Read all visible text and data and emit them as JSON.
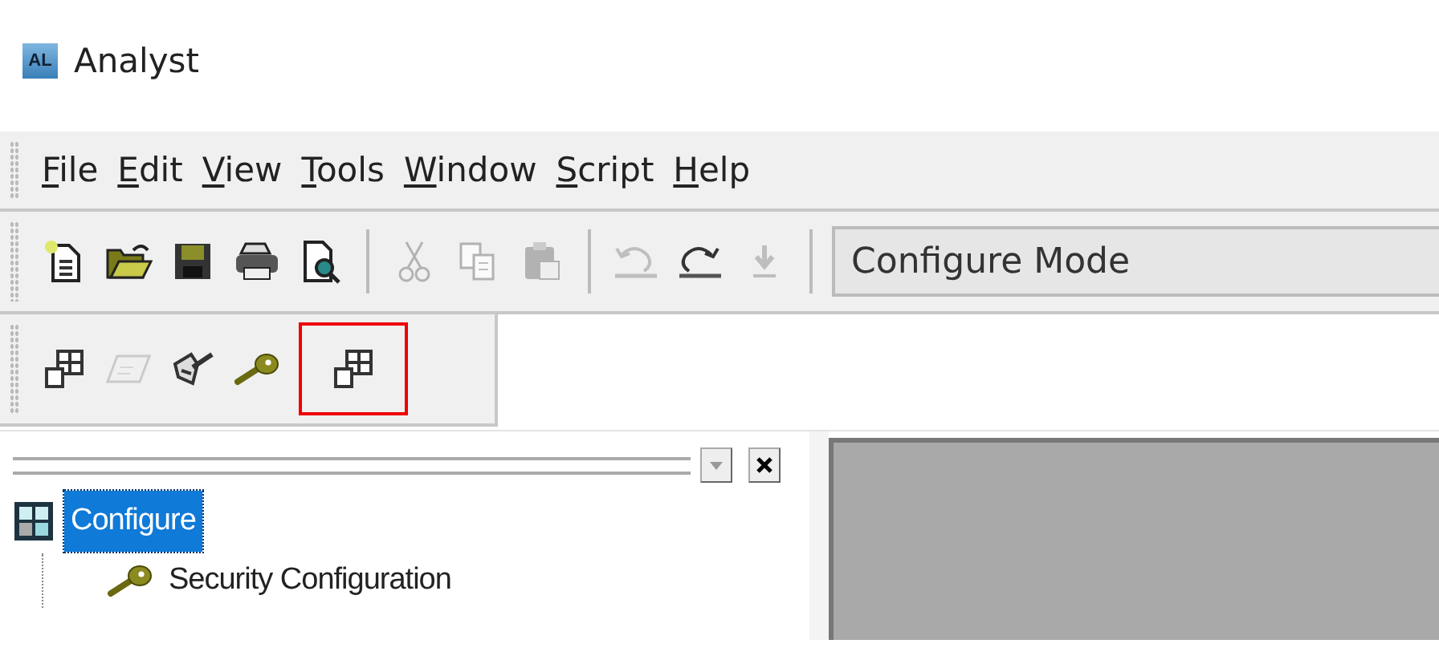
{
  "window": {
    "title": "Analyst",
    "logo": "AL"
  },
  "menu": [
    "File",
    "Edit",
    "View",
    "Tools",
    "Window",
    "Script",
    "Help"
  ],
  "toolbar": {
    "groups": [
      [
        {
          "kind": "new",
          "disabled": false,
          "highlighted": false
        },
        {
          "kind": "open",
          "disabled": false,
          "highlighted": false
        },
        {
          "kind": "save",
          "disabled": false,
          "highlighted": false
        },
        {
          "kind": "print",
          "disabled": false,
          "highlighted": false
        },
        {
          "kind": "preview",
          "disabled": false,
          "highlighted": false
        }
      ],
      [
        {
          "kind": "cut",
          "disabled": true,
          "highlighted": false
        },
        {
          "kind": "copy",
          "disabled": true,
          "highlighted": false
        },
        {
          "kind": "paste",
          "disabled": true,
          "highlighted": false
        }
      ],
      [
        {
          "kind": "undo",
          "disabled": true,
          "highlighted": false
        },
        {
          "kind": "redo",
          "disabled": false,
          "highlighted": false
        },
        {
          "kind": "down",
          "disabled": true,
          "highlighted": false
        }
      ]
    ],
    "mode_field": {
      "value": "Configure Mode"
    }
  },
  "toolbar_2": {
    "tools": [
      {
        "kind": "grid",
        "disabled": false,
        "highlighted": false
      },
      {
        "kind": "slant",
        "disabled": true,
        "highlighted": false
      },
      {
        "kind": "tool",
        "disabled": false,
        "highlighted": false
      },
      {
        "kind": "key",
        "disabled": false,
        "highlighted": false
      },
      {
        "kind": "grid",
        "disabled": false,
        "highlighted": true
      }
    ]
  },
  "tree": {
    "items": [
      {
        "label": "Configure",
        "kind": "grid",
        "selected": true,
        "children": [
          {
            "label": "Security Configuration",
            "kind": "key",
            "selected": false
          }
        ]
      }
    ]
  }
}
